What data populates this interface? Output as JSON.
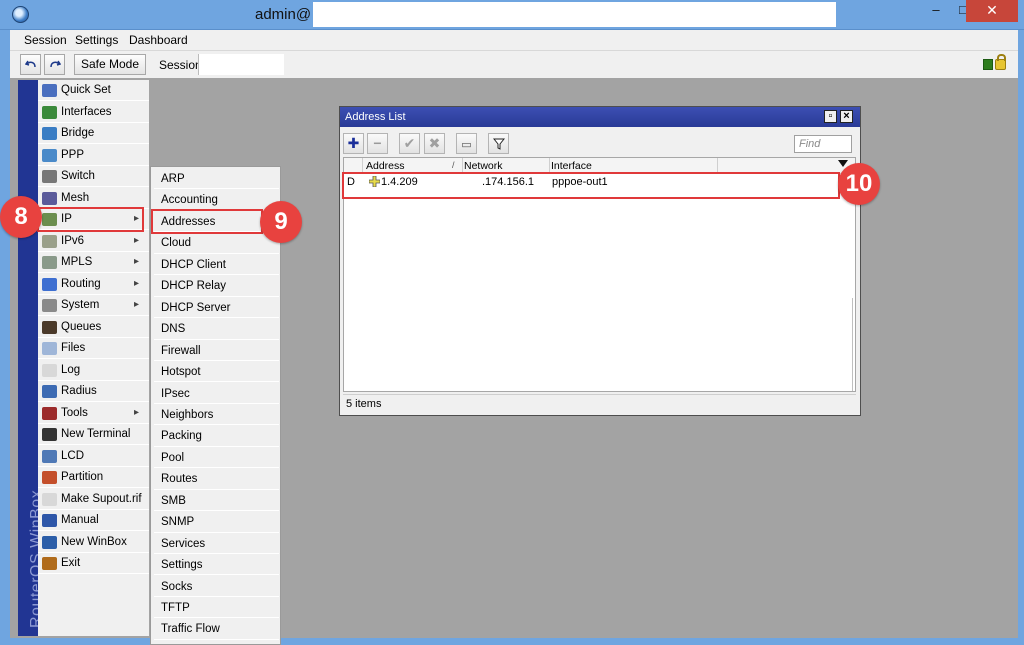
{
  "window": {
    "title": "admin@",
    "minimize": "–",
    "maximize": "□",
    "close": "✕"
  },
  "menubar": [
    "Session",
    "Settings",
    "Dashboard"
  ],
  "toolbar": {
    "undo_icon": "undo-icon",
    "redo_icon": "redo-icon",
    "safe_mode": "Safe Mode",
    "session_label": "Session:",
    "session_value": ""
  },
  "brand": "RouterOS WinBox",
  "sidebar": [
    {
      "label": "Quick Set",
      "icon": "quick-set-icon",
      "arrow": false
    },
    {
      "label": "Interfaces",
      "icon": "interfaces-icon",
      "arrow": false
    },
    {
      "label": "Bridge",
      "icon": "bridge-icon",
      "arrow": false
    },
    {
      "label": "PPP",
      "icon": "ppp-icon",
      "arrow": false
    },
    {
      "label": "Switch",
      "icon": "switch-icon",
      "arrow": false
    },
    {
      "label": "Mesh",
      "icon": "mesh-icon",
      "arrow": false
    },
    {
      "label": "IP",
      "icon": "ip-icon",
      "arrow": true
    },
    {
      "label": "IPv6",
      "icon": "ipv6-icon",
      "arrow": true
    },
    {
      "label": "MPLS",
      "icon": "mpls-icon",
      "arrow": true
    },
    {
      "label": "Routing",
      "icon": "routing-icon",
      "arrow": true
    },
    {
      "label": "System",
      "icon": "system-icon",
      "arrow": true
    },
    {
      "label": "Queues",
      "icon": "queues-icon",
      "arrow": false
    },
    {
      "label": "Files",
      "icon": "files-icon",
      "arrow": false
    },
    {
      "label": "Log",
      "icon": "log-icon",
      "arrow": false
    },
    {
      "label": "Radius",
      "icon": "radius-icon",
      "arrow": false
    },
    {
      "label": "Tools",
      "icon": "tools-icon",
      "arrow": true
    },
    {
      "label": "New Terminal",
      "icon": "terminal-icon",
      "arrow": false
    },
    {
      "label": "LCD",
      "icon": "lcd-icon",
      "arrow": false
    },
    {
      "label": "Partition",
      "icon": "partition-icon",
      "arrow": false
    },
    {
      "label": "Make Supout.rif",
      "icon": "supout-icon",
      "arrow": false
    },
    {
      "label": "Manual",
      "icon": "manual-icon",
      "arrow": false
    },
    {
      "label": "New WinBox",
      "icon": "winbox-icon",
      "arrow": false
    },
    {
      "label": "Exit",
      "icon": "exit-icon",
      "arrow": false
    }
  ],
  "submenu": [
    "ARP",
    "Accounting",
    "Addresses",
    "Cloud",
    "DHCP Client",
    "DHCP Relay",
    "DHCP Server",
    "DNS",
    "Firewall",
    "Hotspot",
    "IPsec",
    "Neighbors",
    "Packing",
    "Pool",
    "Routes",
    "SMB",
    "SNMP",
    "Services",
    "Settings",
    "Socks",
    "TFTP",
    "Traffic Flow"
  ],
  "dialog": {
    "title": "Address List",
    "find_placeholder": "Find",
    "columns": [
      "Address",
      "Network",
      "Interface"
    ],
    "rows": [
      {
        "flag": "D",
        "address": "1.4.209",
        "network": ".174.156.1",
        "interface": "pppoe-out1"
      }
    ],
    "status": "5 items"
  },
  "callouts": [
    "8",
    "9",
    "10"
  ],
  "colors": {
    "titlebar": "#6fa5e0",
    "brand_strip": "#213593",
    "dialog_title": "#2e3f9f",
    "highlight": "#e0393a",
    "badge": "#e8423f",
    "workspace": "#a3a3a3"
  }
}
